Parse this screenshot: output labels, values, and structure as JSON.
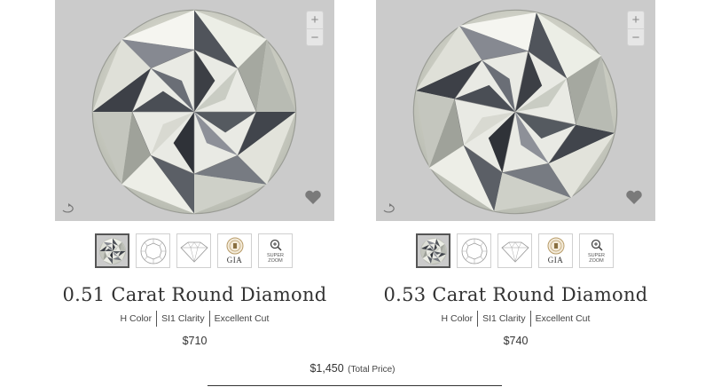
{
  "products": [
    {
      "title": "0.51 Carat Round Diamond",
      "specs": [
        "H Color",
        "SI1 Clarity",
        "Excellent Cut"
      ],
      "price": "$710",
      "zoom_in": "+",
      "zoom_out": "−",
      "thumbs": [
        {
          "name": "photo-thumb",
          "icon": "diamond-photo-icon",
          "active": true
        },
        {
          "name": "top-diagram-thumb",
          "icon": "diamond-top-diagram-icon"
        },
        {
          "name": "profile-diagram-thumb",
          "icon": "diamond-profile-diagram-icon"
        },
        {
          "name": "gia-thumb",
          "icon": "gia-certificate-icon",
          "label": "GIA"
        },
        {
          "name": "super-zoom-thumb",
          "icon": "magnifier-icon",
          "label": "SUPER ZOOM"
        }
      ]
    },
    {
      "title": "0.53 Carat Round Diamond",
      "specs": [
        "H Color",
        "SI1 Clarity",
        "Excellent Cut"
      ],
      "price": "$740",
      "zoom_in": "+",
      "zoom_out": "−",
      "thumbs": [
        {
          "name": "photo-thumb",
          "icon": "diamond-photo-icon",
          "active": true
        },
        {
          "name": "top-diagram-thumb",
          "icon": "diamond-top-diagram-icon"
        },
        {
          "name": "profile-diagram-thumb",
          "icon": "diamond-profile-diagram-icon"
        },
        {
          "name": "gia-thumb",
          "icon": "gia-certificate-icon",
          "label": "GIA"
        },
        {
          "name": "super-zoom-thumb",
          "icon": "magnifier-icon",
          "label": "SUPER ZOOM"
        }
      ]
    }
  ],
  "total": {
    "amount": "$1,450",
    "label": "(Total Price)"
  },
  "colors": {
    "viewer_bg": "#cbcbcb",
    "text": "#333333",
    "thumb_border": "#d0d0d0",
    "active_border": "#555555"
  }
}
